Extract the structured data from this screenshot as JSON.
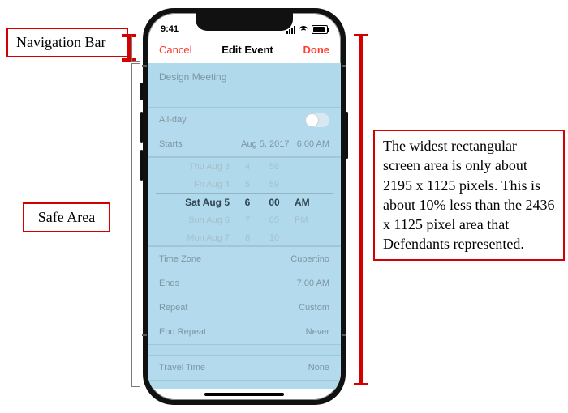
{
  "callouts": {
    "nav_label": "Navigation Bar",
    "safe_label": "Safe Area",
    "right_text": "The widest rectangular screen area is only about 2195 x 1125 pixels. This is about 10% less than the 2436 x 1125 pixel area that Defendants represented."
  },
  "statusbar": {
    "time": "9:41"
  },
  "navbar": {
    "cancel": "Cancel",
    "title": "Edit Event",
    "done": "Done"
  },
  "event": {
    "title": "Design Meeting"
  },
  "allday": {
    "label": "All-day"
  },
  "starts": {
    "label": "Starts",
    "date": "Aug 5, 2017",
    "time": "6:00 AM"
  },
  "picker": {
    "r0": {
      "day": "Thu Aug 3",
      "h": "4",
      "m": "58",
      "ap": ""
    },
    "r1": {
      "day": "Fri Aug 4",
      "h": "5",
      "m": "59",
      "ap": ""
    },
    "sel": {
      "day": "Sat Aug 5",
      "h": "6",
      "m": "00",
      "ap": "AM"
    },
    "r3": {
      "day": "Sun Aug 6",
      "h": "7",
      "m": "05",
      "ap": "PM"
    },
    "r4": {
      "day": "Mon Aug 7",
      "h": "8",
      "m": "10",
      "ap": ""
    }
  },
  "rows": {
    "timezone": {
      "label": "Time Zone",
      "value": "Cupertino"
    },
    "ends": {
      "label": "Ends",
      "value": "7:00 AM"
    },
    "repeat": {
      "label": "Repeat",
      "value": "Custom"
    },
    "endrepeat": {
      "label": "End Repeat",
      "value": "Never"
    },
    "travel": {
      "label": "Travel Time",
      "value": "None"
    }
  }
}
